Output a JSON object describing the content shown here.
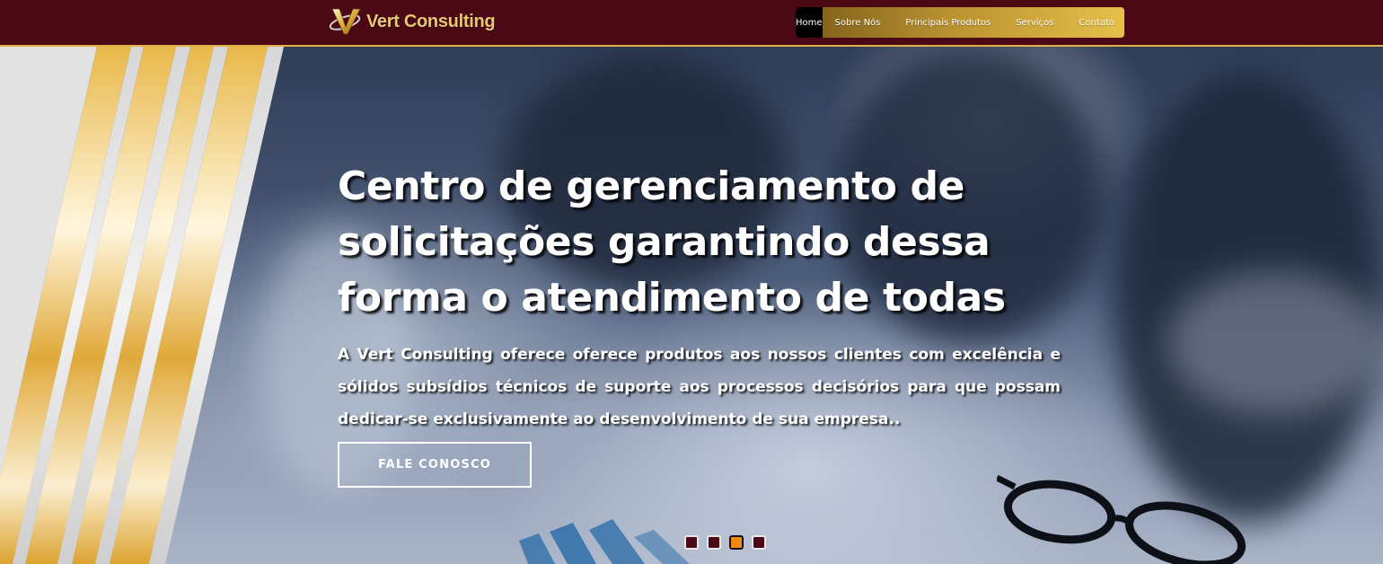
{
  "brand": {
    "name": "Vert Consulting",
    "gold": "#e8c773",
    "maroon": "#4a0914"
  },
  "nav": {
    "items": [
      {
        "label": "Home",
        "active": true
      },
      {
        "label": "Sobre Nós",
        "active": false
      },
      {
        "label": "Principais Produtos",
        "active": false
      },
      {
        "label": "Serviços",
        "active": false
      },
      {
        "label": "Contato",
        "active": false
      }
    ]
  },
  "hero": {
    "title": "Centro de gerenciamento de solicitações garantindo dessa forma o atendimento de todas",
    "description": "A Vert Consulting oferece oferece produtos aos nossos clientes com excelência e sólidos subsídios técnicos de suporte aos processos decisórios para que possam dedicar-se exclusivamente ao desenvolvimento de sua empresa..",
    "cta_label": "FALE CONOSCO",
    "slides": {
      "count": 4,
      "active_index": 3
    }
  },
  "icons": {
    "logo": "v-swoosh-logo",
    "slide_indicator": "slide-dot"
  }
}
